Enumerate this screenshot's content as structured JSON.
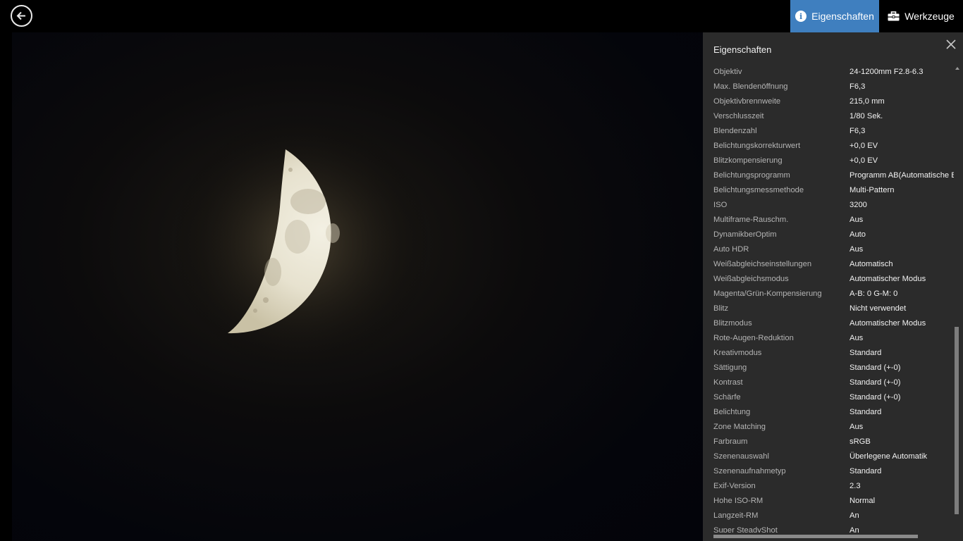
{
  "topbar": {
    "properties_tab": "Eigenschaften",
    "tools_tab": "Werkzeuge"
  },
  "panel": {
    "title": "Eigenschaften",
    "properties": [
      {
        "label": "Objektiv",
        "value": "24-1200mm F2.8-6.3"
      },
      {
        "label": "Max. Blendenöffnung",
        "value": "F6,3"
      },
      {
        "label": "Objektivbrennweite",
        "value": "215,0 mm"
      },
      {
        "label": "Verschlusszeit",
        "value": "1/80 Sek."
      },
      {
        "label": "Blendenzahl",
        "value": "F6,3"
      },
      {
        "label": "Belichtungskorrekturwert",
        "value": "+0,0 EV"
      },
      {
        "label": "Blitzkompensierung",
        "value": "+0,0 EV"
      },
      {
        "label": "Belichtungsprogramm",
        "value": "Programm AB(Automatische Belichtung)"
      },
      {
        "label": "Belichtungsmessmethode",
        "value": "Multi-Pattern"
      },
      {
        "label": "ISO",
        "value": "3200"
      },
      {
        "label": "Multiframe-Rauschm.",
        "value": "Aus"
      },
      {
        "label": "DynamikberOptim",
        "value": "Auto"
      },
      {
        "label": "Auto HDR",
        "value": "Aus"
      },
      {
        "label": "Weißabgleichseinstellungen",
        "value": "Automatisch"
      },
      {
        "label": "Weißabgleichsmodus",
        "value": "Automatischer Modus"
      },
      {
        "label": "Magenta/Grün-Kompensierung",
        "value": "A-B: 0 G-M: 0"
      },
      {
        "label": "Blitz",
        "value": "Nicht verwendet"
      },
      {
        "label": "Blitzmodus",
        "value": "Automatischer Modus"
      },
      {
        "label": "Rote-Augen-Reduktion",
        "value": "Aus"
      },
      {
        "label": "Kreativmodus",
        "value": "Standard"
      },
      {
        "label": "Sättigung",
        "value": "Standard (+-0)"
      },
      {
        "label": "Kontrast",
        "value": "Standard (+-0)"
      },
      {
        "label": "Schärfe",
        "value": "Standard (+-0)"
      },
      {
        "label": "Belichtung",
        "value": "Standard"
      },
      {
        "label": "Zone Matching",
        "value": "Aus"
      },
      {
        "label": "Farbraum",
        "value": "sRGB"
      },
      {
        "label": "Szenenauswahl",
        "value": "Überlegene Automatik"
      },
      {
        "label": "Szenenaufnahmetyp",
        "value": "Standard"
      },
      {
        "label": "Exif-Version",
        "value": "2.3"
      },
      {
        "label": "Hohe ISO-RM",
        "value": "Normal"
      },
      {
        "label": "Langzeit-RM",
        "value": "An"
      },
      {
        "label": "Super SteadyShot",
        "value": "An"
      }
    ]
  },
  "colors": {
    "accent": "#3f7fbf",
    "panel_bg": "#2b2b2b",
    "background": "#000000"
  },
  "icons": {
    "back": "arrow-left-circle-icon",
    "info": "info-icon",
    "tools": "toolbox-icon",
    "close": "close-icon"
  }
}
